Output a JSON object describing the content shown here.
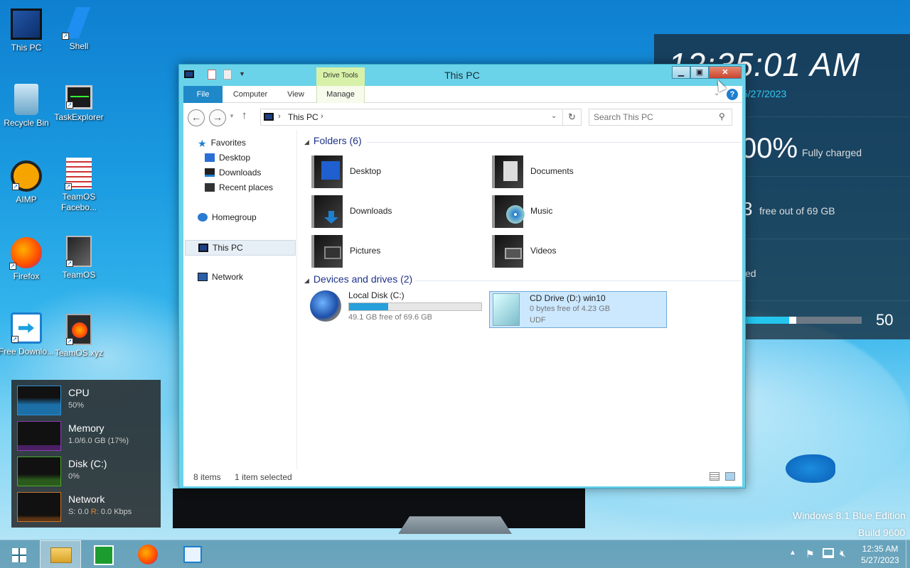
{
  "desktop": {
    "icons": [
      "This PC",
      "Shell",
      "Recycle Bin",
      "TaskExplorer",
      "AIMP",
      "TeamOS Facebo...",
      "Firefox",
      "TeamOS",
      "Free Downlo...",
      "TeamOS.xyz"
    ],
    "watermark_line1": "Windows 8.1 Blue Edition",
    "watermark_line2": "Build 9600"
  },
  "gadget": {
    "clock": "12:35:01 AM",
    "date": "5/27/2023",
    "battery_percent": "00%",
    "battery_status": "Fully charged",
    "disk_num": "3",
    "disk_text": "free out of 69 GB",
    "partial_text": "ed",
    "slider_value": "50",
    "slider_fraction": 0.5
  },
  "window": {
    "title": "This PC",
    "contextual_tab": "Drive Tools",
    "tabs": {
      "file": "File",
      "computer": "Computer",
      "view": "View",
      "manage": "Manage"
    },
    "address_crumb": "This PC",
    "search_placeholder": "Search This PC",
    "nav": {
      "favorites": "Favorites",
      "desktop": "Desktop",
      "downloads": "Downloads",
      "recent": "Recent places",
      "homegroup": "Homegroup",
      "thispc": "This PC",
      "network": "Network"
    },
    "folders_header": "Folders (6)",
    "folders": [
      "Desktop",
      "Documents",
      "Downloads",
      "Music",
      "Pictures",
      "Videos"
    ],
    "devices_header": "Devices and drives (2)",
    "drives": [
      {
        "name": "Local Disk (C:)",
        "detail": "49.1 GB free of 69.6 GB",
        "used_fraction": 0.295
      },
      {
        "name": "CD Drive (D:) win10",
        "detail": "0 bytes free of 4.23 GB",
        "fs": "UDF"
      }
    ],
    "status_items": "8 items",
    "status_selected": "1 item selected"
  },
  "perf": {
    "cpu": {
      "name": "CPU",
      "value": "50%"
    },
    "memory": {
      "name": "Memory",
      "value": "1.0/6.0 GB (17%)"
    },
    "disk": {
      "name": "Disk (C:)",
      "value": "0%"
    },
    "network": {
      "name": "Network",
      "value_s": "S: 0.0",
      "value_r": "R:",
      "value_rest": "0.0 Kbps"
    }
  },
  "taskbar": {
    "time": "12:35 AM",
    "date": "5/27/2023"
  },
  "colors": {
    "accent": "#1e88c8",
    "window_frame": "#6ad3ea",
    "close": "#c9452e"
  }
}
